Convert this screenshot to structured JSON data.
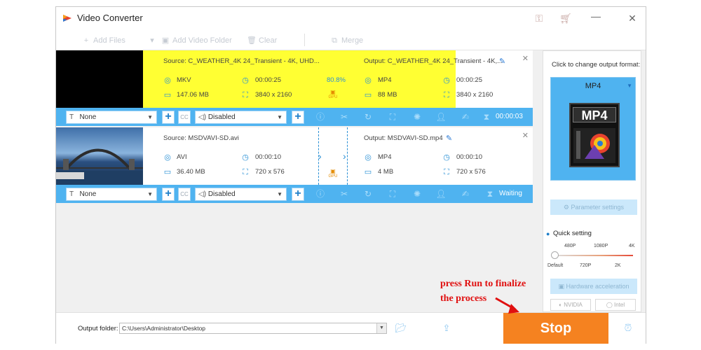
{
  "window": {
    "title": "Video Converter",
    "icons": {
      "key": "key-icon",
      "cart": "cart-icon"
    }
  },
  "toolbar": {
    "add_files": "Add Files",
    "add_video_folder": "Add Video Folder",
    "clear": "Clear",
    "merge": "Merge"
  },
  "tasks": [
    {
      "source": "Source: C_WEATHER_4K 24_Transient - 4K, UHD...",
      "src_format": "MKV",
      "src_duration": "00:00:25",
      "src_size": "147.06 MB",
      "src_resolution": "3840 x 2160",
      "progress": "80.8%",
      "output": "Output: C_WEATHER_4K 24_Transient - 4K,...",
      "out_format": "MP4",
      "out_duration": "00:00:25",
      "out_size": "88 MB",
      "out_resolution": "3840 x 2160",
      "subtitle": "None",
      "audio": "Disabled",
      "status": "00:00:03",
      "gpu": "GPU"
    },
    {
      "source": "Source: MSDVAVI-SD.avi",
      "src_format": "AVI",
      "src_duration": "00:00:10",
      "src_size": "36.40 MB",
      "src_resolution": "720 x 576",
      "output": "Output: MSDVAVI-SD.mp4",
      "out_format": "MP4",
      "out_duration": "00:00:10",
      "out_size": "4 MB",
      "out_resolution": "720 x 576",
      "subtitle": "None",
      "audio": "Disabled",
      "status": "Waiting",
      "gpu": "GPU"
    }
  ],
  "side": {
    "title": "Click to change output format:",
    "format": "MP4",
    "format_tile": "MP4",
    "parameter_settings": "Parameter settings",
    "quick_setting": "Quick setting",
    "ticks_top": [
      "480P",
      "1080P",
      "4K"
    ],
    "ticks_bottom": [
      "Default",
      "720P",
      "2K"
    ],
    "hardware_acceleration": "Hardware acceleration",
    "chip_nvidia": "NVIDIA",
    "chip_intel": "Intel"
  },
  "bottom": {
    "output_folder_label": "Output folder:",
    "output_folder_path": "C:\\Users\\Administrator\\Desktop",
    "stop": "Stop"
  },
  "annotation": {
    "line1": "press Run to finalize",
    "line2": "the process"
  },
  "colors": {
    "accent": "#4fb3f0",
    "highlight": "#ffff33",
    "stop": "#f58220",
    "annotation": "#e01010"
  }
}
